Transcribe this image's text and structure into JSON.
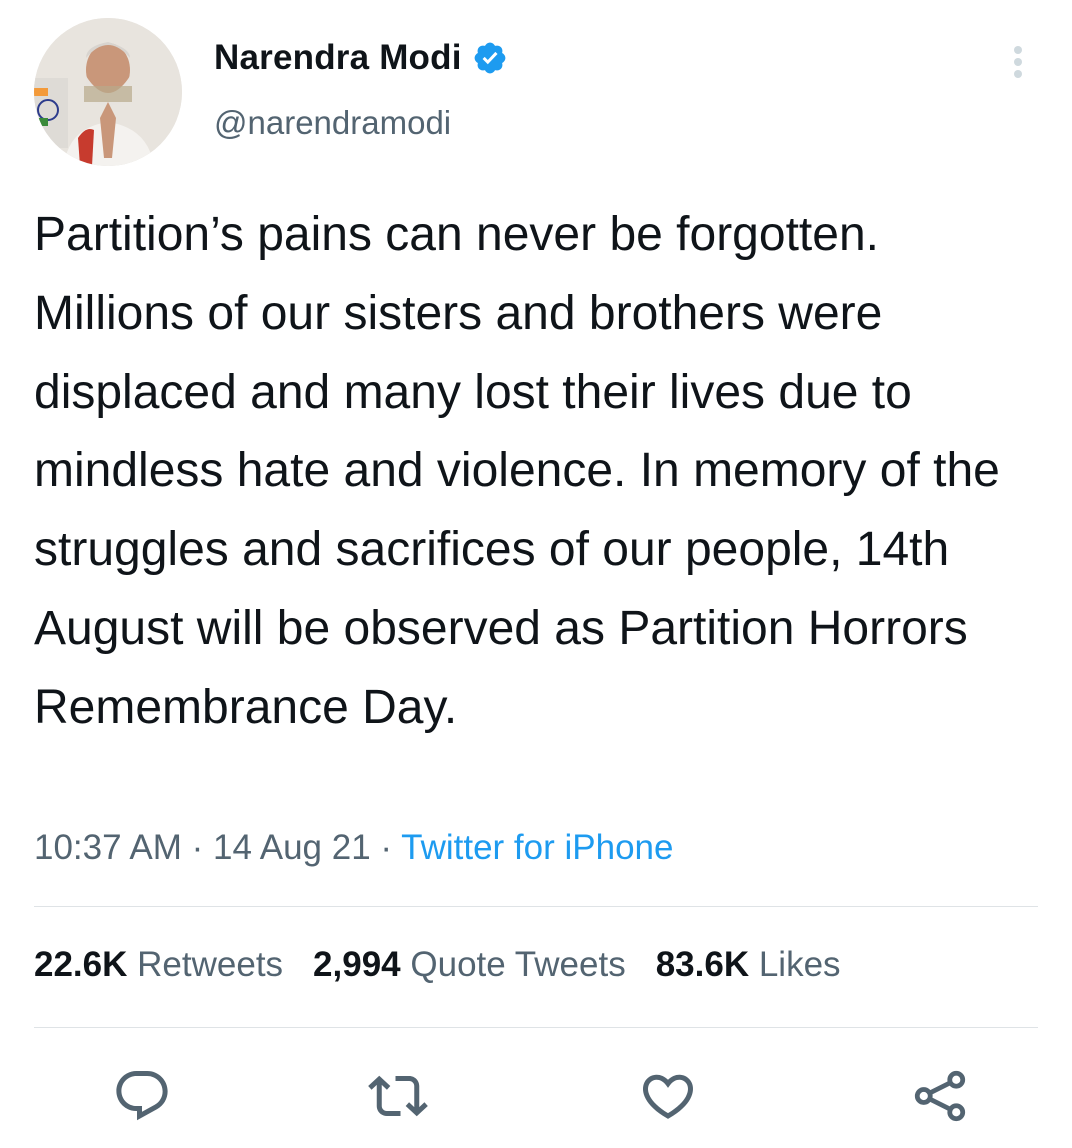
{
  "tweet": {
    "author_name": "Narendra Modi",
    "handle": "@narendramodi",
    "text": "Partition’s pains can never be forgotten. Millions of our sisters and brothers were displaced and many lost their lives due to mindless hate and violence. In memory of the struggles and sacrifices of our people, 14th August will be observed as Partition Horrors Remembrance Day.",
    "time": "10:37 AM",
    "date": "14 Aug 21",
    "source": "Twitter for iPhone",
    "separator": " · "
  },
  "stats": {
    "retweets_count": "22.6K",
    "retweets_label": "Retweets",
    "quotes_count": "2,994",
    "quotes_label": "Quote Tweets",
    "likes_count": "83.6K",
    "likes_label": "Likes"
  },
  "icons": {
    "verified": "verified-badge-icon",
    "more": "more-vertical-icon",
    "reply": "reply-icon",
    "retweet": "retweet-icon",
    "like": "heart-icon",
    "share": "share-icon"
  },
  "colors": {
    "accent": "#1d9bf0",
    "secondary_text": "#536471",
    "primary_text": "#0f1419",
    "divider": "#dfe3e6"
  }
}
